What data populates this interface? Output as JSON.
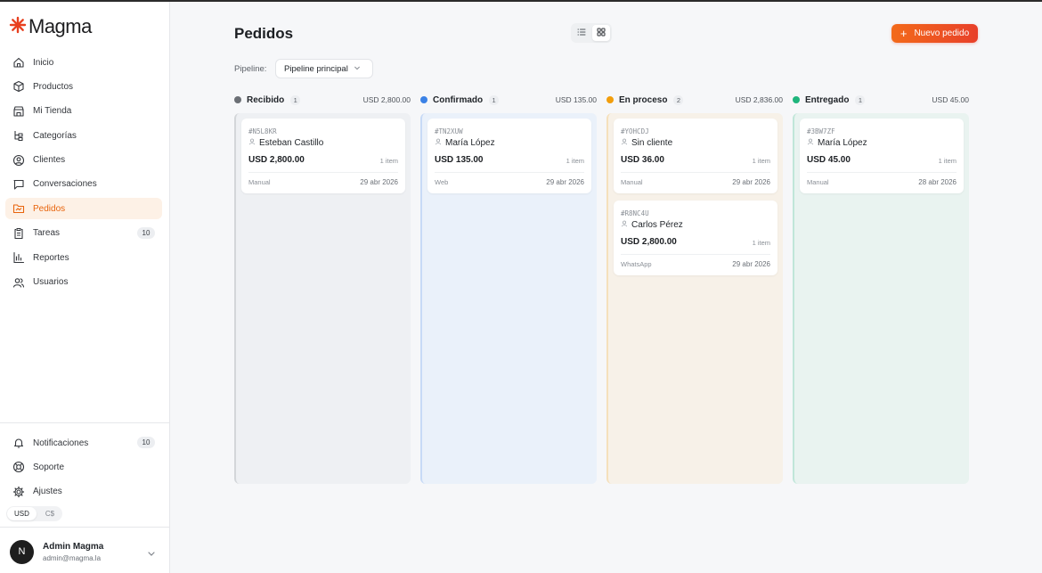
{
  "sidebar": {
    "logo": "Magma",
    "items": [
      {
        "label": "Inicio",
        "icon": "home-icon"
      },
      {
        "label": "Productos",
        "icon": "box-icon"
      },
      {
        "label": "Mi Tienda",
        "icon": "store-icon"
      },
      {
        "label": "Categorías",
        "icon": "tree-icon"
      },
      {
        "label": "Clientes",
        "icon": "user-circle-icon"
      },
      {
        "label": "Conversaciones",
        "icon": "chat-icon"
      },
      {
        "label": "Pedidos",
        "icon": "folder-icon",
        "active": true
      },
      {
        "label": "Tareas",
        "icon": "clipboard-icon",
        "badge": "10"
      },
      {
        "label": "Reportes",
        "icon": "bar-chart-icon"
      },
      {
        "label": "Usuarios",
        "icon": "users-icon"
      }
    ],
    "bottom_items": [
      {
        "label": "Notificaciones",
        "icon": "bell-icon",
        "badge": "10"
      },
      {
        "label": "Soporte",
        "icon": "lifebuoy-icon"
      },
      {
        "label": "Ajustes",
        "icon": "gear-icon"
      }
    ],
    "currency": {
      "options": [
        "USD",
        "C$"
      ],
      "selected": "USD"
    },
    "user": {
      "initial": "N",
      "name": "Admin Magma",
      "email": "admin@magma.la"
    }
  },
  "header": {
    "title": "Pedidos",
    "new_button": "Nuevo pedido",
    "pipeline_label": "Pipeline:",
    "pipeline_value": "Pipeline principal"
  },
  "columns": [
    {
      "title": "Recibido",
      "count": "1",
      "total": "USD 2,800.00",
      "color": "#6b6f75",
      "bg": "#eef0f3",
      "cards": [
        {
          "id": "#N5L8KR",
          "customer": "Esteban Castillo",
          "amount": "USD 2,800.00",
          "items": "1 item",
          "source": "Manual",
          "date": "29 abr 2026"
        }
      ]
    },
    {
      "title": "Confirmado",
      "count": "1",
      "total": "USD 135.00",
      "color": "#3b82e6",
      "bg": "#eaf1fa",
      "cards": [
        {
          "id": "#TN2XUW",
          "customer": "María López",
          "amount": "USD 135.00",
          "items": "1 item",
          "source": "Web",
          "date": "29 abr 2026"
        }
      ]
    },
    {
      "title": "En proceso",
      "count": "2",
      "total": "USD 2,836.00",
      "color": "#f29e0c",
      "bg": "#f7f1e8",
      "cards": [
        {
          "id": "#YOHCDJ",
          "customer": "Sin cliente",
          "amount": "USD 36.00",
          "items": "1 item",
          "source": "Manual",
          "date": "29 abr 2026"
        },
        {
          "id": "#R8NC4U",
          "customer": "Carlos Pérez",
          "amount": "USD 2,800.00",
          "items": "1 item",
          "source": "WhatsApp",
          "date": "29 abr 2026"
        }
      ]
    },
    {
      "title": "Entregado",
      "count": "1",
      "total": "USD 45.00",
      "color": "#1fb57c",
      "bg": "#e9f3f0",
      "cards": [
        {
          "id": "#3BW7ZF",
          "customer": "María López",
          "amount": "USD 45.00",
          "items": "1 item",
          "source": "Manual",
          "date": "28 abr 2026"
        }
      ]
    }
  ]
}
